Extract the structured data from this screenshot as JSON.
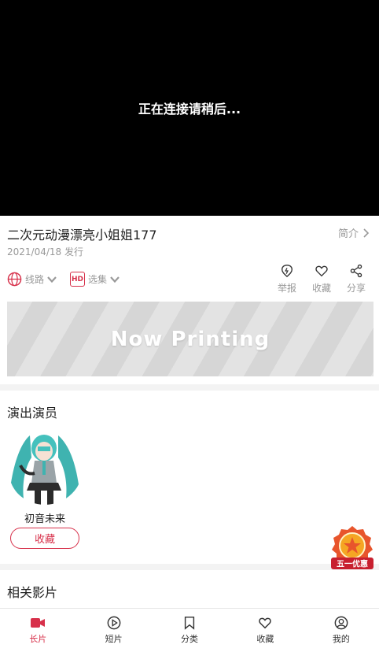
{
  "player": {
    "message": "正在连接请稍后..."
  },
  "video": {
    "title": "二次元动漫漂亮小姐姐177",
    "date": "2021/04/18 发行",
    "intro_label": "简介"
  },
  "options": {
    "route_label": "线路",
    "episode_label": "选集",
    "hd_badge": "HD"
  },
  "actions": {
    "report": "举报",
    "favorite": "收藏",
    "share": "分享"
  },
  "banner": {
    "text": "Now Printing"
  },
  "cast": {
    "title": "演出演员",
    "actors": [
      {
        "name": "初音未来",
        "follow_label": "收藏"
      }
    ]
  },
  "related": {
    "title": "相关影片"
  },
  "promo": {
    "text": "五一优惠"
  },
  "tabbar": {
    "items": [
      {
        "label": "长片",
        "icon": "video-icon",
        "active": true
      },
      {
        "label": "短片",
        "icon": "play-circle-icon"
      },
      {
        "label": "分类",
        "icon": "bookmark-icon"
      },
      {
        "label": "收藏",
        "icon": "heart-icon"
      },
      {
        "label": "我的",
        "icon": "user-icon"
      }
    ]
  },
  "colors": {
    "accent": "#d7304a",
    "muted": "#999999"
  }
}
